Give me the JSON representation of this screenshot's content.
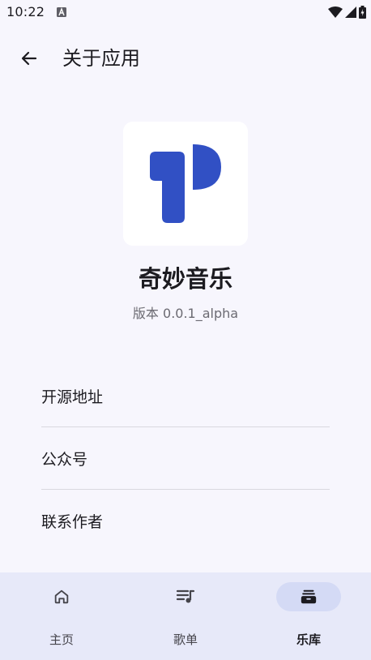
{
  "status_bar": {
    "time": "10:22"
  },
  "header": {
    "title": "关于应用",
    "back_icon": "arrow-back-icon"
  },
  "app_info": {
    "name": "奇妙音乐",
    "version": "版本 0.0.1_alpha",
    "logo_color": "#3150c4"
  },
  "menu": {
    "items": [
      {
        "label": "开源地址"
      },
      {
        "label": "公众号"
      },
      {
        "label": "联系作者"
      }
    ]
  },
  "bottom_nav": {
    "items": [
      {
        "label": "主页",
        "icon": "home-icon",
        "active": false
      },
      {
        "label": "歌单",
        "icon": "playlist-icon",
        "active": false
      },
      {
        "label": "乐库",
        "icon": "library-icon",
        "active": true
      }
    ]
  },
  "colors": {
    "background": "#f7f6fd",
    "nav_background": "#e7e9f9",
    "active_pill": "#d4daf5"
  }
}
